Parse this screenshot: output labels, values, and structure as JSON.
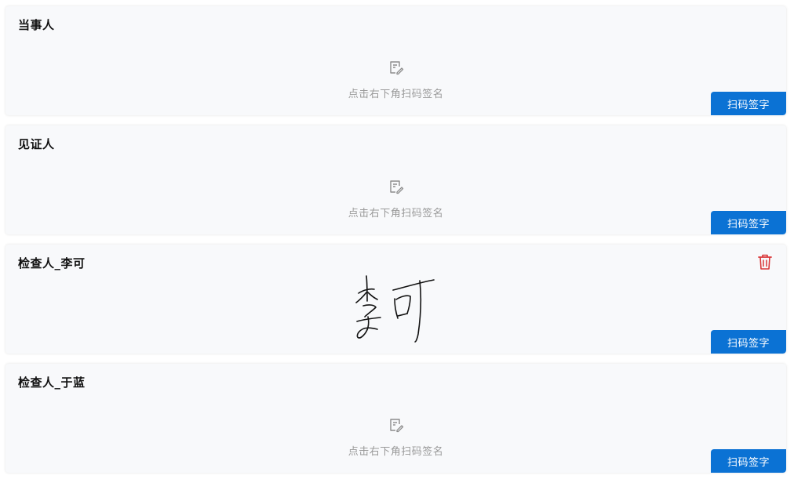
{
  "cards": [
    {
      "title": "当事人",
      "placeholder": "点击右下角扫码签名",
      "button": "扫码签字"
    },
    {
      "title": "见证人",
      "placeholder": "点击右下角扫码签名",
      "button": "扫码签字"
    },
    {
      "title": "检查人_李可",
      "button": "扫码签字",
      "signed": true,
      "delete_icon": "trash-icon"
    },
    {
      "title": "检查人_于蓝",
      "placeholder": "点击右下角扫码签名",
      "button": "扫码签字"
    }
  ],
  "colors": {
    "accent": "#0b72d4",
    "delete": "#d9373a",
    "card_bg": "#f8f9fb"
  },
  "icons": {
    "placeholder": "edit-note-icon",
    "delete": "trash-icon"
  }
}
